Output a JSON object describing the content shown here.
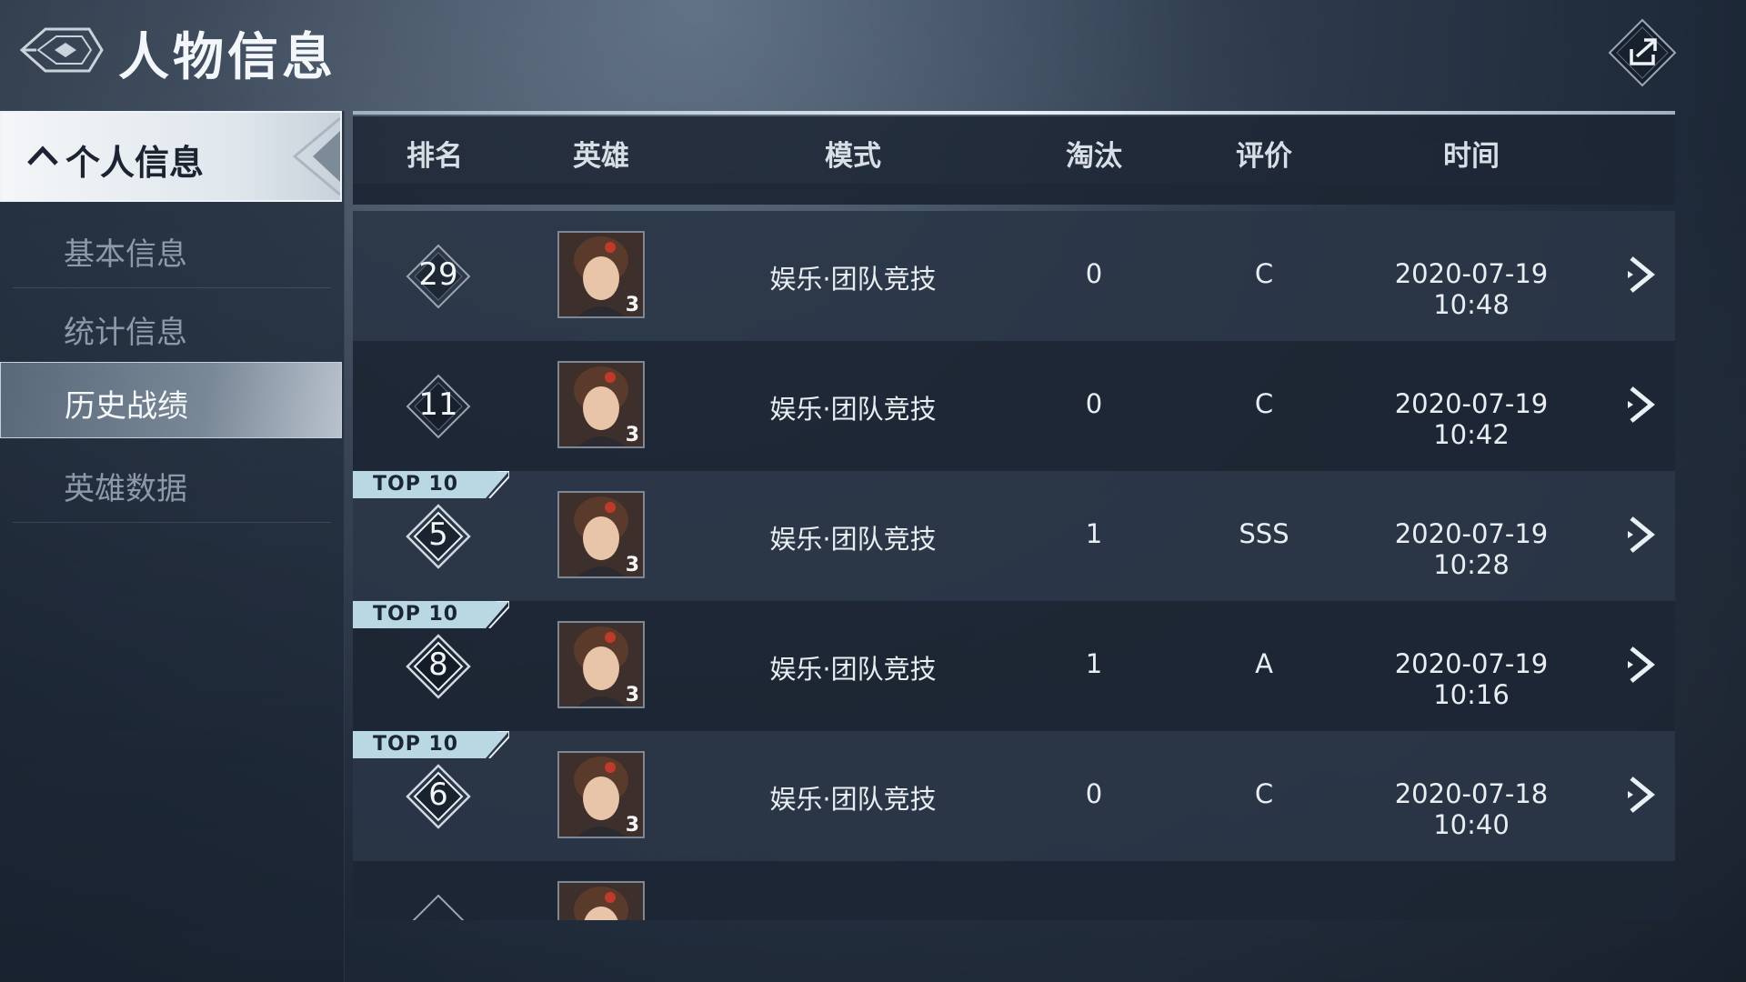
{
  "header": {
    "title": "人物信息",
    "back_icon": "wing-emblem-icon",
    "share_icon": "share-icon"
  },
  "sidebar": {
    "section_label": "个人信息",
    "items": [
      {
        "label": "基本信息",
        "active": false
      },
      {
        "label": "统计信息",
        "active": false
      },
      {
        "label": "历史战绩",
        "active": true
      },
      {
        "label": "英雄数据",
        "active": false
      }
    ]
  },
  "table": {
    "columns": [
      "排名",
      "英雄",
      "模式",
      "淘汰",
      "评价",
      "时间"
    ],
    "rows": [
      {
        "rank": "29",
        "badge": "",
        "hero_level": "3",
        "mode": "娱乐·团队竞技",
        "eliminations": "0",
        "rating": "C",
        "time": "2020-07-19 10:48"
      },
      {
        "rank": "11",
        "badge": "",
        "hero_level": "3",
        "mode": "娱乐·团队竞技",
        "eliminations": "0",
        "rating": "C",
        "time": "2020-07-19 10:42"
      },
      {
        "rank": "5",
        "badge": "TOP 10",
        "hero_level": "3",
        "mode": "娱乐·团队竞技",
        "eliminations": "1",
        "rating": "SSS",
        "time": "2020-07-19 10:28"
      },
      {
        "rank": "8",
        "badge": "TOP 10",
        "hero_level": "3",
        "mode": "娱乐·团队竞技",
        "eliminations": "1",
        "rating": "A",
        "time": "2020-07-19 10:16"
      },
      {
        "rank": "6",
        "badge": "TOP 10",
        "hero_level": "3",
        "mode": "娱乐·团队竞技",
        "eliminations": "0",
        "rating": "C",
        "time": "2020-07-18 10:40"
      }
    ]
  },
  "colors": {
    "badge_bg": "#b9d8e3",
    "row_light": "#2a3646",
    "row_dark": "#1c2634",
    "accent": "#e9f0f6"
  }
}
